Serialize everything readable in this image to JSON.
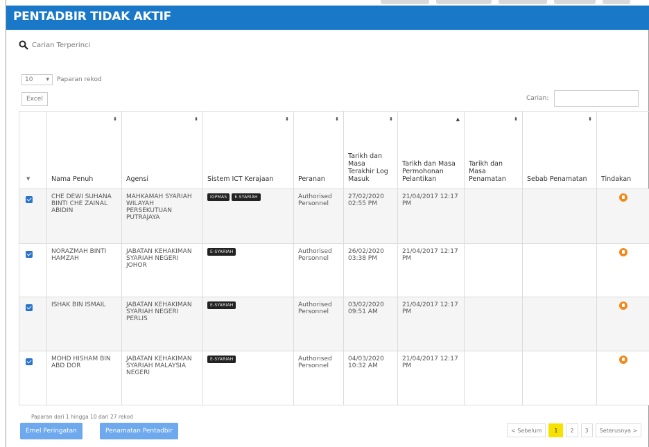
{
  "header": {
    "title": "PENTADBIR TIDAK AKTIF"
  },
  "search_link": {
    "label": "Carian Terperinci"
  },
  "page_size": {
    "value": "10",
    "label": "Paparan rekod"
  },
  "toolbar": {
    "excel_label": "Excel",
    "search_label": "Carian:",
    "search_value": ""
  },
  "table": {
    "headers": {
      "nama": "Nama Penuh",
      "agensi": "Agensi",
      "sistem": "Sistem ICT Kerajaan",
      "peranan": "Peranan",
      "log": "Tarikh dan Masa Terakhir Log Masuk",
      "mohon": "Tarikh dan Masa Permohonan Pelantikan",
      "tamat": "Tarikh dan Masa Penamatan",
      "sebab": "Sebab Penamatan",
      "tindakan": "Tindakan"
    },
    "rows": [
      {
        "nama": "CHE DEWI SUHANA BINTI CHE ZAINAL ABIDIN",
        "agensi": "MAHKAMAH SYARIAH WILAYAH PERSEKUTUAN PUTRAJAYA",
        "sistem": [
          "IGPMAS",
          "E-SYARIAH"
        ],
        "peranan": "Authorised Personnel",
        "log": "27/02/2020 02:55 PM",
        "mohon": "21/04/2017 12:17 PM",
        "tamat": "",
        "sebab": ""
      },
      {
        "nama": "NORAZMAH BINTI HAMZAH",
        "agensi": "JABATAN KEHAKIMAN SYARIAH NEGERI JOHOR",
        "sistem": [
          "E-SYARIAH"
        ],
        "peranan": "Authorised Personnel",
        "log": "26/02/2020 03:38 PM",
        "mohon": "21/04/2017 12:17 PM",
        "tamat": "",
        "sebab": ""
      },
      {
        "nama": "ISHAK BIN ISMAIL",
        "agensi": "JABATAN KEHAKIMAN SYARIAH NEGERI PERLIS",
        "sistem": [
          "E-SYARIAH"
        ],
        "peranan": "Authorised Personnel",
        "log": "03/02/2020 09:51 AM",
        "mohon": "21/04/2017 12:17 PM",
        "tamat": "",
        "sebab": ""
      },
      {
        "nama": "MOHD HISHAM BIN ABD DOR",
        "agensi": "JABATAN KEHAKIMAN SYARIAH MALAYSIA NEGERI",
        "sistem": [
          "E-SYARIAH"
        ],
        "peranan": "Authorised Personnel",
        "log": "04/03/2020 10:32 AM",
        "mohon": "21/04/2017 12:17 PM",
        "tamat": "",
        "sebab": ""
      }
    ]
  },
  "footer": {
    "info": "Paparan dari 1 hingga 10 dari 27 rekod",
    "email_button": "Emel Peringatan",
    "terminate_button": "Penamatan Pentadbir",
    "pager": {
      "prev": "< Sebelum",
      "pages": [
        "1",
        "2",
        "3"
      ],
      "active": "1",
      "next": "Seterusnya >"
    }
  },
  "colors": {
    "header_bg": "#1a78c8",
    "button_bg": "#6ea9ee",
    "action_icon": "#f08a1c",
    "pager_active": "#f6e100",
    "checkbox": "#2b73c9"
  }
}
